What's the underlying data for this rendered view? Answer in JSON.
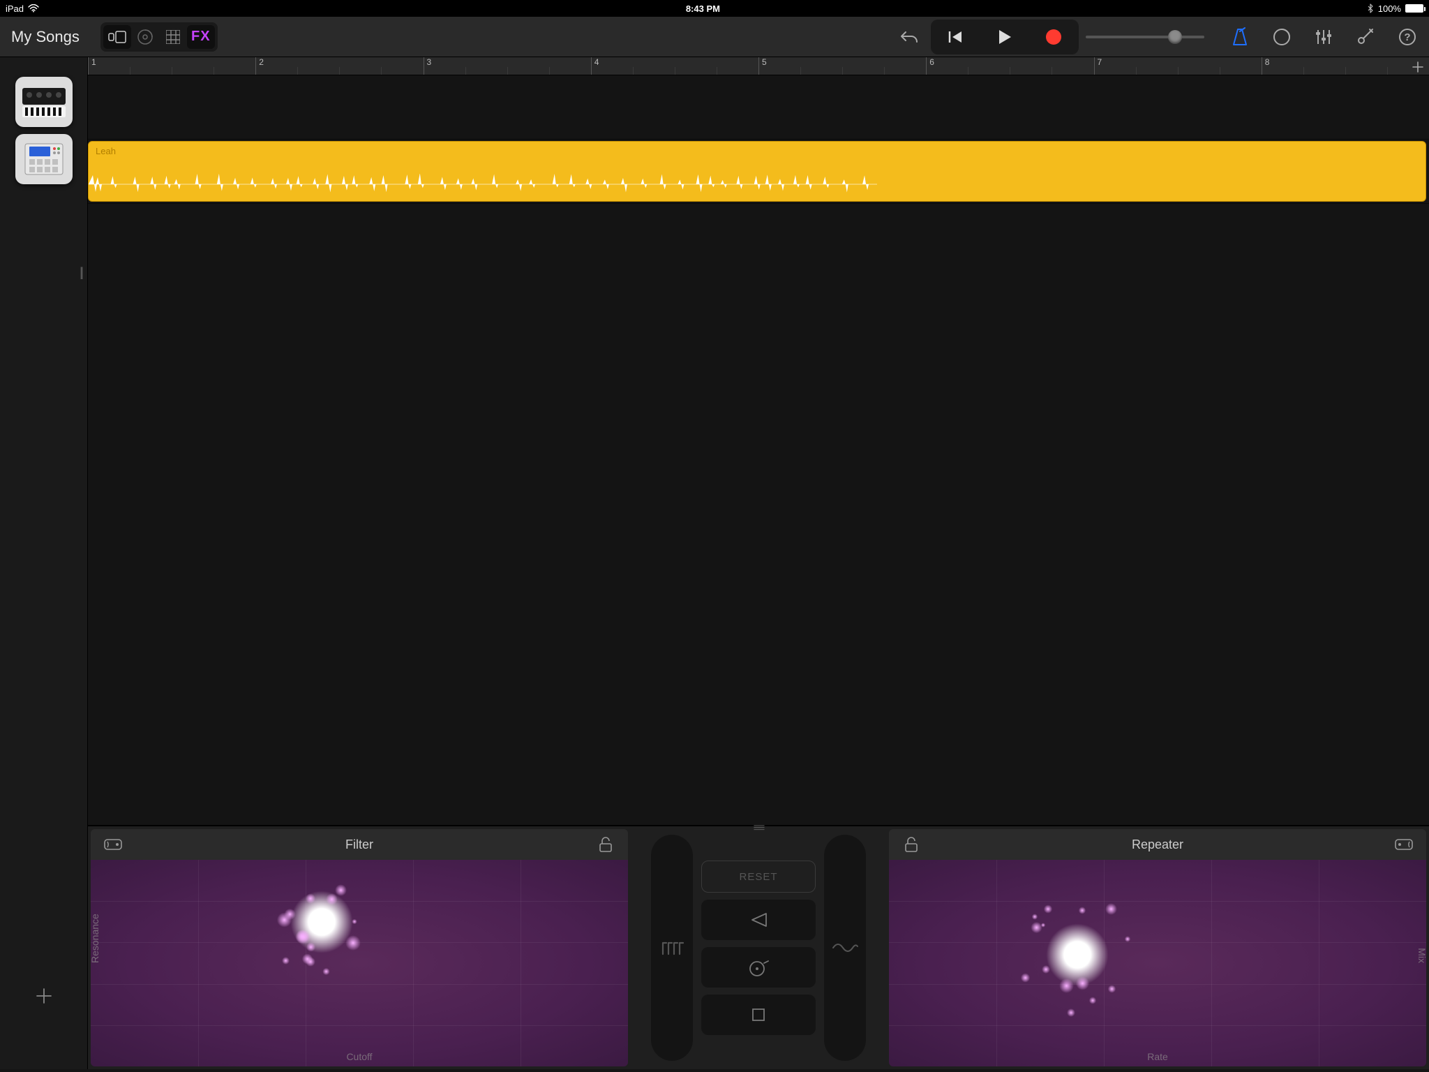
{
  "statusbar": {
    "device": "iPad",
    "time": "8:43 PM",
    "battery_pct": "100%"
  },
  "toolbar": {
    "my_songs": "My Songs",
    "fx_label": "FX"
  },
  "ruler": {
    "bars": [
      "1",
      "2",
      "3",
      "4",
      "5",
      "6",
      "7",
      "8"
    ],
    "beats_per_bar": 4
  },
  "tracks": {
    "track1": {
      "instrument": "synth"
    },
    "track2": {
      "instrument": "sampler",
      "region_name": "Leah"
    }
  },
  "fx": {
    "left": {
      "name": "Filter",
      "xaxis": "Cutoff",
      "yaxis": "Resonance",
      "touch_x_pct": 43,
      "touch_y_pct": 30
    },
    "right": {
      "name": "Repeater",
      "xaxis": "Rate",
      "yaxis": "Mix",
      "touch_x_pct": 35,
      "touch_y_pct": 46
    },
    "center": {
      "reset": "RESET"
    }
  },
  "colors": {
    "region": "#f4bc1c",
    "fx_accent": "#c642ff",
    "pad_bg": "#4a2050",
    "metronome_active": "#1f6fff",
    "record": "#ff3b30"
  }
}
